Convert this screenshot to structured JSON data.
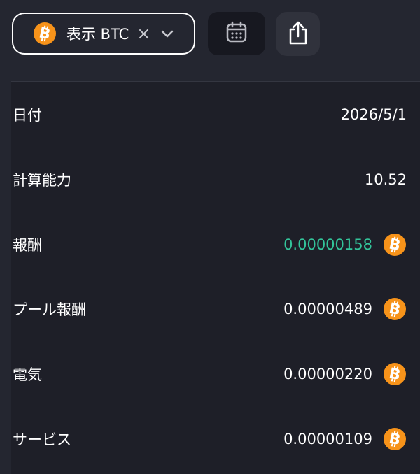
{
  "toolbar": {
    "filter_label": "表示 BTC",
    "filter_clear": "×",
    "filter_icon": "bitcoin-icon",
    "calendar_icon": "calendar-icon",
    "share_icon": "share-icon",
    "chevron_icon": "chevron-down-icon"
  },
  "colors": {
    "background": "#242630",
    "panel": "#1e1f28",
    "bitcoin": "#f7931a",
    "positive": "#33c49a"
  },
  "details": [
    {
      "label": "日付",
      "value": "2026/5/1",
      "coin": ""
    },
    {
      "label": "計算能力",
      "value": "10.52",
      "coin": ""
    },
    {
      "label": "報酬",
      "value": "0.00000158",
      "coin": "bitcoin-icon",
      "highlight": true
    },
    {
      "label": "プール報酬",
      "value": "0.00000489",
      "coin": "bitcoin-icon"
    },
    {
      "label": "電気",
      "value": "0.00000220",
      "coin": "bitcoin-icon"
    },
    {
      "label": "サービス",
      "value": "0.00000109",
      "coin": "bitcoin-icon"
    }
  ]
}
